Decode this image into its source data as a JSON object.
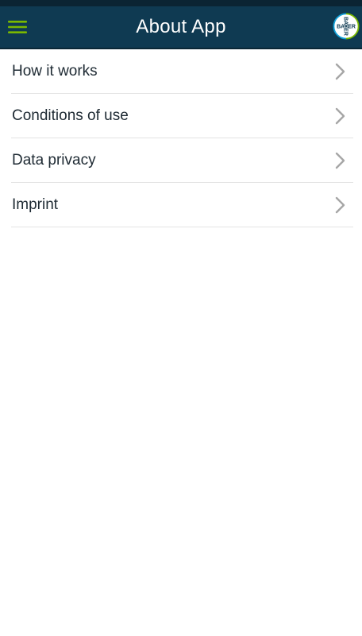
{
  "header": {
    "title": "About App",
    "menu_icon": "hamburger-menu-icon",
    "logo_icon": "bayer-cross-logo",
    "logo_text": "BAYER",
    "accent_color": "#7ab800",
    "bar_color": "#0f3a52"
  },
  "menu": {
    "items": [
      {
        "label": "How it works",
        "icon": "chevron-right-icon"
      },
      {
        "label": "Conditions of use",
        "icon": "chevron-right-icon"
      },
      {
        "label": "Data privacy",
        "icon": "chevron-right-icon"
      },
      {
        "label": "Imprint",
        "icon": "chevron-right-icon"
      }
    ]
  }
}
